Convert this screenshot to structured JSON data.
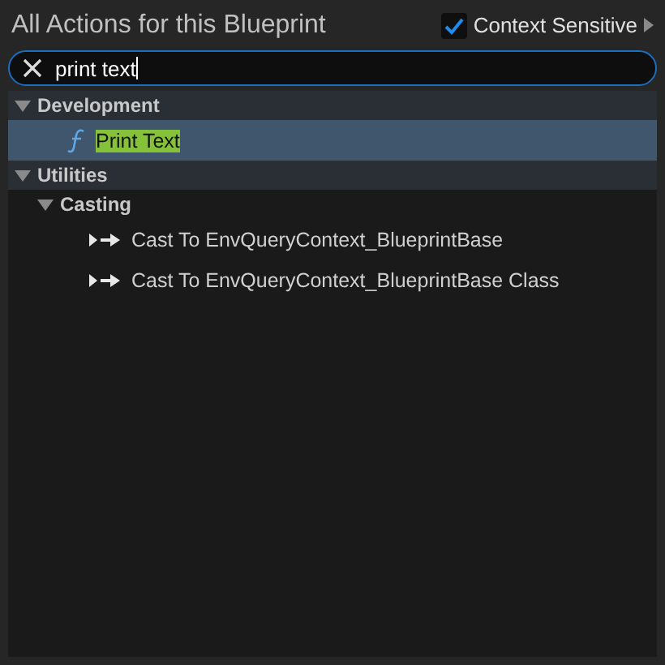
{
  "title": "All Actions for this Blueprint",
  "context_sensitive": {
    "label": "Context Sensitive",
    "checked": true
  },
  "search": {
    "value": "print text"
  },
  "tree": [
    {
      "label": "Development",
      "expanded": true,
      "children": [
        {
          "kind": "function",
          "label": "Print Text",
          "selected": true,
          "match": true
        }
      ]
    },
    {
      "label": "Utilities",
      "expanded": true,
      "children": [
        {
          "label": "Casting",
          "expanded": true,
          "children": [
            {
              "kind": "cast",
              "label": "Cast To EnvQueryContext_BlueprintBase",
              "selected": false,
              "match": false
            },
            {
              "kind": "cast",
              "label": "Cast To EnvQueryContext_BlueprintBase Class",
              "selected": false,
              "match": false
            }
          ]
        }
      ]
    }
  ]
}
